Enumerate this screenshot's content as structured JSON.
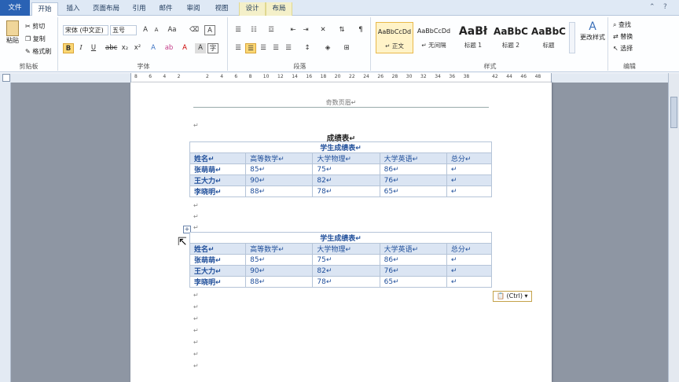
{
  "tabs": [
    "文件",
    "开始",
    "插入",
    "页面布局",
    "引用",
    "邮件",
    "审阅",
    "视图",
    "设计",
    "布局"
  ],
  "clipboard": {
    "paste": "粘贴",
    "cut": "剪切",
    "copy": "复制",
    "painter": "格式刷",
    "group": "剪贴板"
  },
  "font": {
    "name": "宋体 (中文正)",
    "size": "五号",
    "group": "字体"
  },
  "paragraph": {
    "group": "段落"
  },
  "styles": {
    "items": [
      {
        "sample": "AaBbCcDd",
        "name": "↵ 正文"
      },
      {
        "sample": "AaBbCcDd",
        "name": "↵ 无间隔"
      },
      {
        "sample": "AaBł",
        "name": "标题 1"
      },
      {
        "sample": "AaBbC",
        "name": "标题 2"
      },
      {
        "sample": "AaBbC",
        "name": "标题"
      }
    ],
    "change": "更改样式",
    "group": "样式"
  },
  "editing": {
    "find": "查找",
    "replace": "替换",
    "select": "选择",
    "group": "编辑"
  },
  "ruler_ticks": [
    "8",
    "6",
    "4",
    "2",
    "",
    "2",
    "4",
    "6",
    "8",
    "10",
    "12",
    "14",
    "16",
    "18",
    "20",
    "22",
    "24",
    "26",
    "28",
    "30",
    "32",
    "34",
    "36",
    "38",
    "",
    "42",
    "44",
    "46",
    "48"
  ],
  "doc": {
    "header": "奇数页眉↵",
    "mark": "↵",
    "title": "成绩表↵",
    "caption": "学生成绩表↵",
    "headers": [
      "姓名↵",
      "高等数学↵",
      "大学物理↵",
      "大学英语↵",
      "总分↵"
    ],
    "rows": [
      [
        "张萌萌↵",
        "85↵",
        "75↵",
        "86↵",
        "↵"
      ],
      [
        "王大力↵",
        "90↵",
        "82↵",
        "76↵",
        "↵"
      ],
      [
        "李晓明↵",
        "88↵",
        "78↵",
        "65↵",
        "↵"
      ]
    ],
    "anchor": "+",
    "paste_ctrl": "(Ctrl) ▾"
  }
}
